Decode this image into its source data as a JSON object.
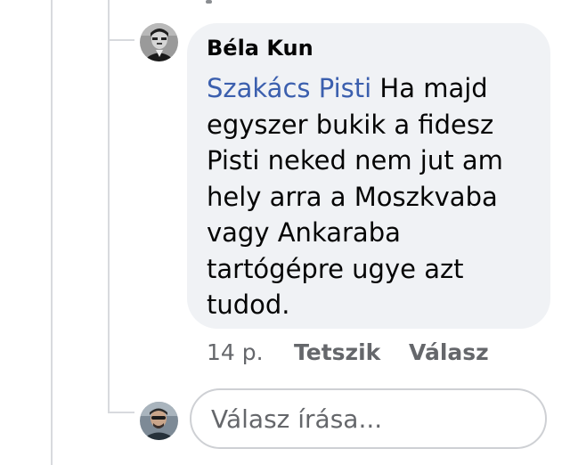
{
  "comment": {
    "author": "Béla Kun",
    "mention": "Szakács Pisti",
    "text_lines": [
      " Ha majd",
      "egyszer bukik a fidesz",
      "Pisti neked nem jut am",
      "hely arra a Moszkvaba",
      "vagy Ankaraba",
      "tartógépre ugye azt",
      "tudod."
    ],
    "timestamp": "14 p.",
    "like_label": "Tetszik",
    "reply_label": "Válasz"
  },
  "reply": {
    "placeholder": "Válasz írása..."
  },
  "colors": {
    "bubble_bg": "#f0f2f5",
    "mention": "#3b5fae",
    "meta_text": "#65676b",
    "thread_line": "#d8dade"
  }
}
